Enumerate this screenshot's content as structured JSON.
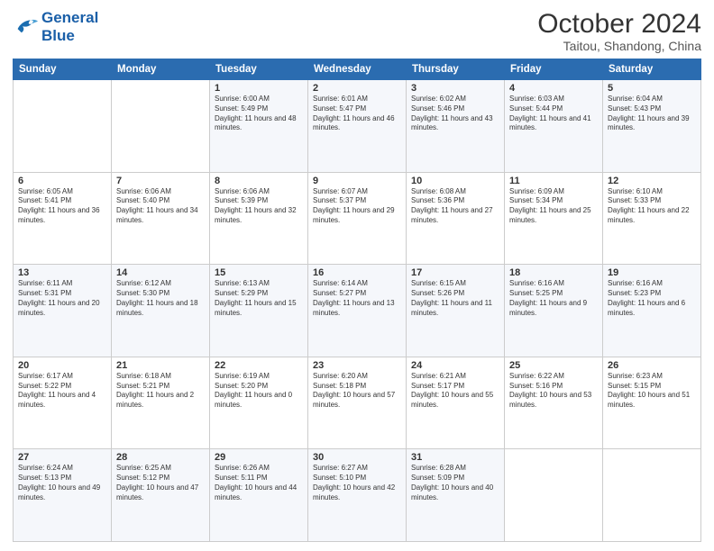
{
  "header": {
    "logo_line1": "General",
    "logo_line2": "Blue",
    "month": "October 2024",
    "location": "Taitou, Shandong, China"
  },
  "weekdays": [
    "Sunday",
    "Monday",
    "Tuesday",
    "Wednesday",
    "Thursday",
    "Friday",
    "Saturday"
  ],
  "weeks": [
    [
      {
        "day": "",
        "info": ""
      },
      {
        "day": "",
        "info": ""
      },
      {
        "day": "1",
        "info": "Sunrise: 6:00 AM\nSunset: 5:49 PM\nDaylight: 11 hours and 48 minutes."
      },
      {
        "day": "2",
        "info": "Sunrise: 6:01 AM\nSunset: 5:47 PM\nDaylight: 11 hours and 46 minutes."
      },
      {
        "day": "3",
        "info": "Sunrise: 6:02 AM\nSunset: 5:46 PM\nDaylight: 11 hours and 43 minutes."
      },
      {
        "day": "4",
        "info": "Sunrise: 6:03 AM\nSunset: 5:44 PM\nDaylight: 11 hours and 41 minutes."
      },
      {
        "day": "5",
        "info": "Sunrise: 6:04 AM\nSunset: 5:43 PM\nDaylight: 11 hours and 39 minutes."
      }
    ],
    [
      {
        "day": "6",
        "info": "Sunrise: 6:05 AM\nSunset: 5:41 PM\nDaylight: 11 hours and 36 minutes."
      },
      {
        "day": "7",
        "info": "Sunrise: 6:06 AM\nSunset: 5:40 PM\nDaylight: 11 hours and 34 minutes."
      },
      {
        "day": "8",
        "info": "Sunrise: 6:06 AM\nSunset: 5:39 PM\nDaylight: 11 hours and 32 minutes."
      },
      {
        "day": "9",
        "info": "Sunrise: 6:07 AM\nSunset: 5:37 PM\nDaylight: 11 hours and 29 minutes."
      },
      {
        "day": "10",
        "info": "Sunrise: 6:08 AM\nSunset: 5:36 PM\nDaylight: 11 hours and 27 minutes."
      },
      {
        "day": "11",
        "info": "Sunrise: 6:09 AM\nSunset: 5:34 PM\nDaylight: 11 hours and 25 minutes."
      },
      {
        "day": "12",
        "info": "Sunrise: 6:10 AM\nSunset: 5:33 PM\nDaylight: 11 hours and 22 minutes."
      }
    ],
    [
      {
        "day": "13",
        "info": "Sunrise: 6:11 AM\nSunset: 5:31 PM\nDaylight: 11 hours and 20 minutes."
      },
      {
        "day": "14",
        "info": "Sunrise: 6:12 AM\nSunset: 5:30 PM\nDaylight: 11 hours and 18 minutes."
      },
      {
        "day": "15",
        "info": "Sunrise: 6:13 AM\nSunset: 5:29 PM\nDaylight: 11 hours and 15 minutes."
      },
      {
        "day": "16",
        "info": "Sunrise: 6:14 AM\nSunset: 5:27 PM\nDaylight: 11 hours and 13 minutes."
      },
      {
        "day": "17",
        "info": "Sunrise: 6:15 AM\nSunset: 5:26 PM\nDaylight: 11 hours and 11 minutes."
      },
      {
        "day": "18",
        "info": "Sunrise: 6:16 AM\nSunset: 5:25 PM\nDaylight: 11 hours and 9 minutes."
      },
      {
        "day": "19",
        "info": "Sunrise: 6:16 AM\nSunset: 5:23 PM\nDaylight: 11 hours and 6 minutes."
      }
    ],
    [
      {
        "day": "20",
        "info": "Sunrise: 6:17 AM\nSunset: 5:22 PM\nDaylight: 11 hours and 4 minutes."
      },
      {
        "day": "21",
        "info": "Sunrise: 6:18 AM\nSunset: 5:21 PM\nDaylight: 11 hours and 2 minutes."
      },
      {
        "day": "22",
        "info": "Sunrise: 6:19 AM\nSunset: 5:20 PM\nDaylight: 11 hours and 0 minutes."
      },
      {
        "day": "23",
        "info": "Sunrise: 6:20 AM\nSunset: 5:18 PM\nDaylight: 10 hours and 57 minutes."
      },
      {
        "day": "24",
        "info": "Sunrise: 6:21 AM\nSunset: 5:17 PM\nDaylight: 10 hours and 55 minutes."
      },
      {
        "day": "25",
        "info": "Sunrise: 6:22 AM\nSunset: 5:16 PM\nDaylight: 10 hours and 53 minutes."
      },
      {
        "day": "26",
        "info": "Sunrise: 6:23 AM\nSunset: 5:15 PM\nDaylight: 10 hours and 51 minutes."
      }
    ],
    [
      {
        "day": "27",
        "info": "Sunrise: 6:24 AM\nSunset: 5:13 PM\nDaylight: 10 hours and 49 minutes."
      },
      {
        "day": "28",
        "info": "Sunrise: 6:25 AM\nSunset: 5:12 PM\nDaylight: 10 hours and 47 minutes."
      },
      {
        "day": "29",
        "info": "Sunrise: 6:26 AM\nSunset: 5:11 PM\nDaylight: 10 hours and 44 minutes."
      },
      {
        "day": "30",
        "info": "Sunrise: 6:27 AM\nSunset: 5:10 PM\nDaylight: 10 hours and 42 minutes."
      },
      {
        "day": "31",
        "info": "Sunrise: 6:28 AM\nSunset: 5:09 PM\nDaylight: 10 hours and 40 minutes."
      },
      {
        "day": "",
        "info": ""
      },
      {
        "day": "",
        "info": ""
      }
    ]
  ]
}
